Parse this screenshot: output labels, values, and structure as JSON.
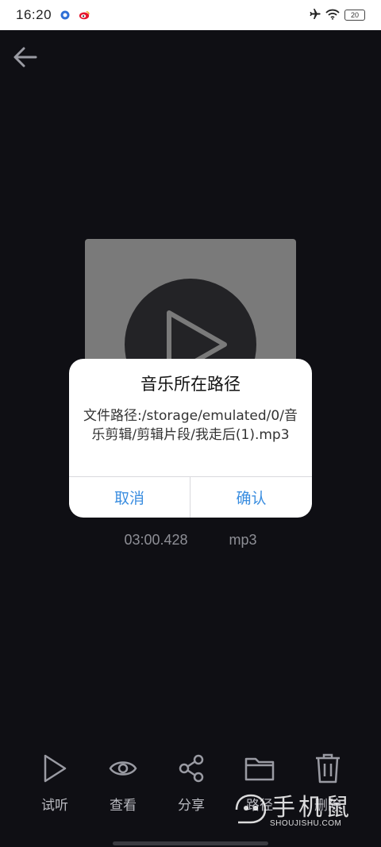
{
  "status_bar": {
    "time": "16:20",
    "battery": "20"
  },
  "track": {
    "duration": "03:00.428",
    "format": "mp3"
  },
  "toolbar": {
    "items": [
      {
        "label": "试听",
        "icon": "play-icon"
      },
      {
        "label": "查看",
        "icon": "eye-icon"
      },
      {
        "label": "分享",
        "icon": "share-icon"
      },
      {
        "label": "路径",
        "icon": "folder-icon"
      },
      {
        "label": "删除",
        "icon": "trash-icon"
      }
    ]
  },
  "dialog": {
    "title": "音乐所在路径",
    "message": "文件路径:/storage/emulated/0/音乐剪辑/剪辑片段/我走后(1).mp3",
    "cancel_label": "取消",
    "confirm_label": "确认"
  },
  "watermark": {
    "brand": "手机鼠",
    "domain": "SHOUJISHU.COM"
  },
  "colors": {
    "background": "#0f0f14",
    "accent": "#3b8ee0",
    "cover": "#7a7a7a"
  }
}
